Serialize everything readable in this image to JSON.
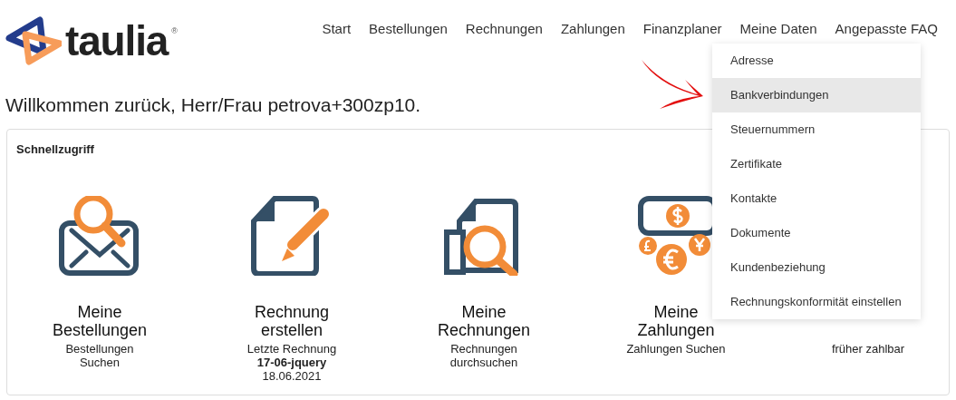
{
  "logo": {
    "text": "taulia",
    "mark": "®"
  },
  "nav": [
    "Start",
    "Bestellungen",
    "Rechnungen",
    "Zahlungen",
    "Finanzplaner",
    "Meine Daten",
    "Angepasste FAQ"
  ],
  "welcome": "Willkommen zurück, Herr/Frau petrova+300zp10.",
  "quick_access": {
    "title": "Schnellzugriff",
    "tiles": [
      {
        "kind": "orders",
        "title": [
          "Meine",
          "Bestellungen"
        ],
        "lines": [
          {
            "text": "Bestellungen",
            "bold": false
          },
          {
            "text": "Suchen",
            "bold": false
          }
        ]
      },
      {
        "kind": "create",
        "title": [
          "Rechnung",
          "erstellen"
        ],
        "lines": [
          {
            "text": "Letzte Rechnung",
            "bold": false
          },
          {
            "text": "17-06-jquery",
            "bold": true
          },
          {
            "text": "18.06.2021",
            "bold": false
          }
        ]
      },
      {
        "kind": "invoices",
        "title": [
          "Meine",
          "Rechnungen"
        ],
        "lines": [
          {
            "text": "Rechnungen",
            "bold": false
          },
          {
            "text": "durchsuchen",
            "bold": false
          }
        ]
      },
      {
        "kind": "payments",
        "title": [
          "Meine",
          "Zahlungen"
        ],
        "lines": [
          {
            "text": "Zahlungen Suchen",
            "bold": false
          }
        ]
      },
      {
        "lines": [
          {
            "text": "früher zahlbar",
            "bold": false
          }
        ]
      }
    ]
  },
  "dropdown": [
    {
      "label": "Adresse",
      "highlighted": false
    },
    {
      "label": "Bankverbindungen",
      "highlighted": true
    },
    {
      "label": "Steuernummern",
      "highlighted": false
    },
    {
      "label": "Zertifikate",
      "highlighted": false
    },
    {
      "label": "Kontakte",
      "highlighted": false
    },
    {
      "label": "Dokumente",
      "highlighted": false
    },
    {
      "label": "Kundenbeziehung",
      "highlighted": false
    },
    {
      "label": "Rechnungskonformität einstellen",
      "highlighted": false
    }
  ]
}
